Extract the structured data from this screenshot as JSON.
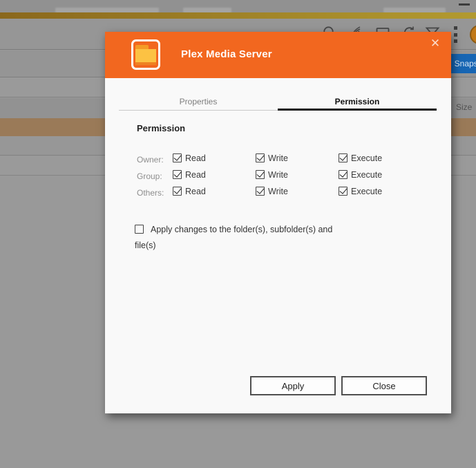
{
  "background": {
    "window": {
      "minimize_icon": "minimize-dash"
    },
    "toolbar": {
      "icons": [
        "search-icon",
        "quill-icon",
        "envelope-icon",
        "refresh-icon",
        "filter-icon",
        "kebab-menu-icon",
        "avatar-circle"
      ]
    },
    "snapshot_button": {
      "label": "Snapshot"
    },
    "file_table": {
      "size_column_label": "Size"
    }
  },
  "dialog": {
    "title": "Plex Media Server",
    "close_label": "✕",
    "tabs": [
      {
        "label": "Properties",
        "active": false
      },
      {
        "label": "Permission",
        "active": true
      }
    ],
    "section_title": "Permission",
    "permissions": {
      "rows": [
        {
          "label": "Owner:",
          "items": [
            {
              "label": "Read",
              "checked": true
            },
            {
              "label": "Write",
              "checked": true
            },
            {
              "label": "Execute",
              "checked": true
            }
          ]
        },
        {
          "label": "Group:",
          "items": [
            {
              "label": "Read",
              "checked": true
            },
            {
              "label": "Write",
              "checked": true
            },
            {
              "label": "Execute",
              "checked": true
            }
          ]
        },
        {
          "label": "Others:",
          "items": [
            {
              "label": "Read",
              "checked": true
            },
            {
              "label": "Write",
              "checked": true
            },
            {
              "label": "Execute",
              "checked": true
            }
          ]
        }
      ]
    },
    "apply_scope_checkbox": {
      "label": "Apply changes to the folder(s), subfolder(s) and file(s)",
      "checked": false
    },
    "buttons": {
      "apply": "Apply",
      "close": "Close"
    }
  },
  "colors": {
    "dialog_header_orange": "#f2671f",
    "folder_yellow": "#fcc243",
    "snapshot_blue": "#1766b4",
    "selected_row_dimmed": "#9a7a58",
    "overlay_gray": "#999999"
  }
}
